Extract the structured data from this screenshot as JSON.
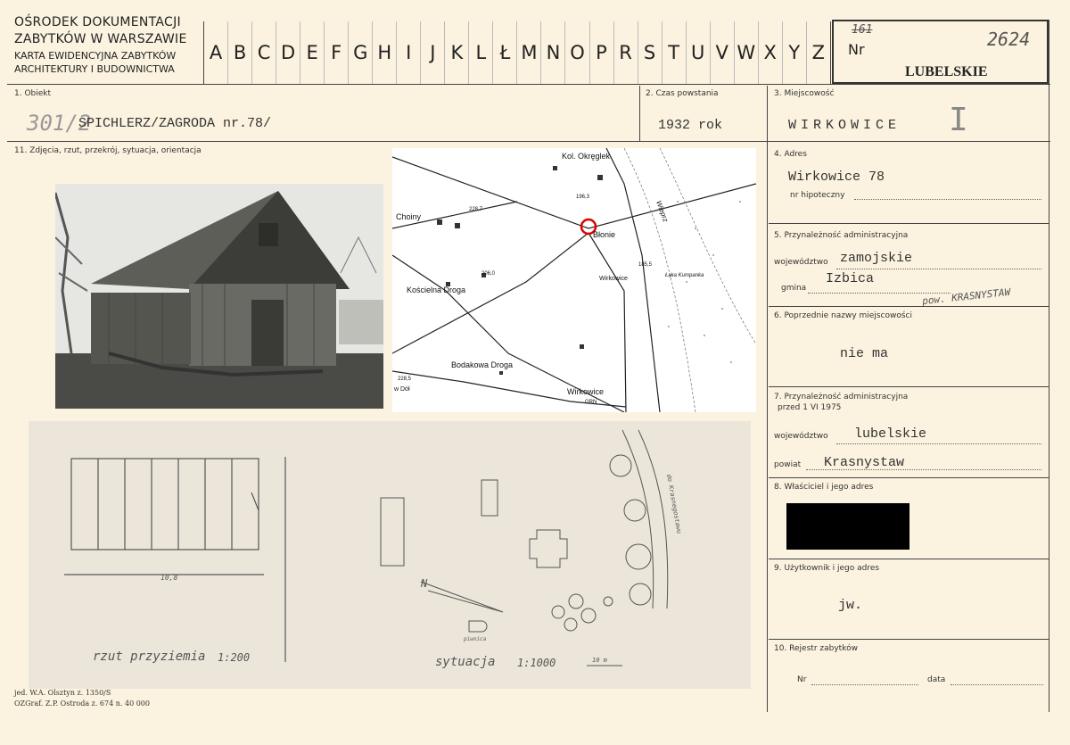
{
  "header": {
    "org_line1": "OŚRODEK DOKUMENTACJI",
    "org_line2": "ZABYTKÓW W WARSZAWIE",
    "org_line3": "KARTA EWIDENCYJNA ZABYTKÓW",
    "org_line4": "ARCHITEKTURY I BUDOWNICTWA",
    "letters": [
      "A",
      "B",
      "C",
      "D",
      "E",
      "F",
      "G",
      "H",
      "I",
      "J",
      "K",
      "L",
      "Ł",
      "M",
      "N",
      "O",
      "P",
      "R",
      "S",
      "T",
      "U",
      "V",
      "W",
      "X",
      "Y",
      "Z"
    ],
    "nr_label": "Nr",
    "nr_handwritten": "2624",
    "nr_struck": "161",
    "region": "LUBELSKIE"
  },
  "fields": {
    "obiekt_label": "1. Obiekt",
    "obiekt_number": "301/2",
    "obiekt_value": "SPICHLERZ/ZAGRODA nr.78/",
    "czas_label": "2. Czas powstania",
    "czas_value": "1932 rok",
    "miejscowosc_label": "3. Miejscowość",
    "miejscowosc_value": "WIRKOWICE",
    "miejscowosc_mark": "I",
    "zdjecia_label": "11. Zdjęcia, rzut, przekrój, sytuacja, orientacja",
    "adres_label": "4. Adres",
    "adres_value": "Wirkowice 78",
    "hipoteczny_label": "nr hipoteczny",
    "przynaleznosc_label": "5. Przynależność administracyjna",
    "wojewodztwo_label": "województwo",
    "wojewodztwo_value": "zamojskie",
    "gmina_label": "gmina",
    "gmina_value": "Izbica",
    "gmina_note": "pow. KRASNYSTAW",
    "poprzednie_label": "6. Poprzednie nazwy miejscowości",
    "poprzednie_value": "nie ma",
    "przynaleznosc_przed_label": "7. Przynależność administracyjna",
    "przynaleznosc_przed_label2": "przed 1 VI 1975",
    "wojewodztwo2_label": "województwo",
    "wojewodztwo2_value": "lubelskie",
    "powiat_label": "powiat",
    "powiat_value": "Krasnystaw",
    "wlasciciel_label": "8. Właściciel i jego adres",
    "uzytkownik_label": "9. Użytkownik i jego adres",
    "uzytkownik_value": "jw.",
    "rejestr_label": "10. Rejestr zabytków",
    "rejestr_nr_label": "Nr",
    "rejestr_data_label": "data"
  },
  "map": {
    "labels": [
      "Kol. Okręglek",
      "Choiny",
      "Błonie",
      "Kościelna Droga",
      "Wirkowice",
      "Bodakowa Droga",
      "Wirkowice GRN",
      "w Dół",
      "Wieprz",
      "Łąka Kumpanka"
    ],
    "elevations": [
      "196,3",
      "228,7",
      "206,0",
      "185,5",
      "228,5"
    ]
  },
  "drawings": {
    "plan_caption": "rzut przyziemia",
    "plan_scale": "1:200",
    "plan_dim": "10,8",
    "site_caption": "sytuacja",
    "site_scale": "1:1000",
    "site_bar": "10 m",
    "north": "N",
    "cellar": "piwnica",
    "road_label": "do Krasnegostawu"
  },
  "footer": {
    "line1": "jed. W.A. Olsztyn z. 1350/S",
    "line2": "OZGraf. Z.P. Ostroda z. 674 n. 40 000"
  }
}
